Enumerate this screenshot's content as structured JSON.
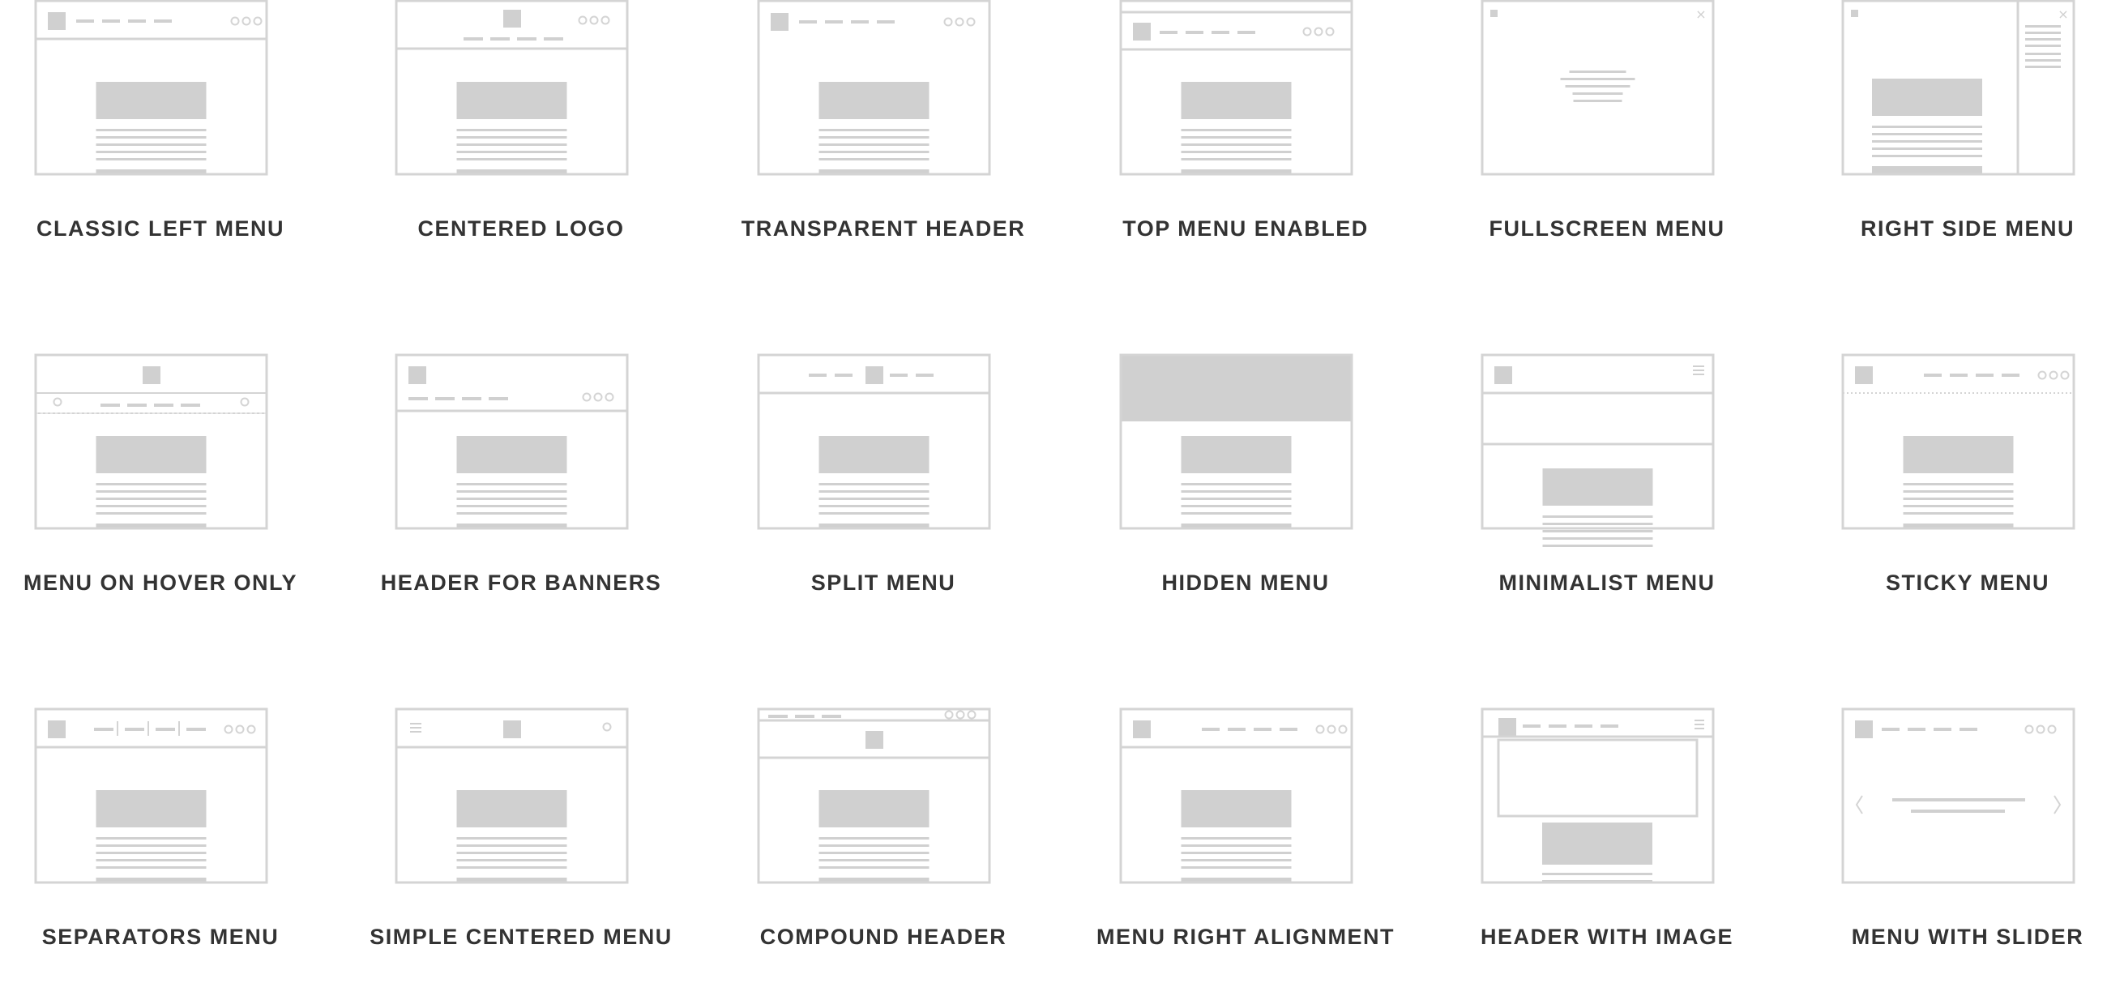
{
  "colors": {
    "stroke": "#d4d4d4",
    "fill": "#d0d0d0",
    "label": "#333333",
    "background": "#ffffff"
  },
  "options": [
    {
      "id": "classic-left-menu",
      "label": "CLASSIC LEFT MENU",
      "layout": "classic-left"
    },
    {
      "id": "centered-logo",
      "label": "CENTERED LOGO",
      "layout": "centered-logo"
    },
    {
      "id": "transparent-header",
      "label": "TRANSPARENT HEADER",
      "layout": "transparent"
    },
    {
      "id": "top-menu-enabled",
      "label": "TOP MENU ENABLED",
      "layout": "top-menu"
    },
    {
      "id": "fullscreen-menu",
      "label": "FULLSCREEN MENU",
      "layout": "fullscreen"
    },
    {
      "id": "right-side-menu",
      "label": "RIGHT SIDE MENU",
      "layout": "right-side"
    },
    {
      "id": "menu-on-hover-only",
      "label": "MENU ON HOVER ONLY",
      "layout": "hover-only"
    },
    {
      "id": "header-for-banners",
      "label": "HEADER FOR BANNERS",
      "layout": "banners"
    },
    {
      "id": "split-menu",
      "label": "SPLIT MENU",
      "layout": "split"
    },
    {
      "id": "hidden-menu",
      "label": "HIDDEN MENU",
      "layout": "hidden"
    },
    {
      "id": "minimalist-menu",
      "label": "MINIMALIST MENU",
      "layout": "minimalist"
    },
    {
      "id": "sticky-menu",
      "label": "STICKY MENU",
      "layout": "sticky"
    },
    {
      "id": "separators-menu",
      "label": "SEPARATORS MENU",
      "layout": "separators"
    },
    {
      "id": "simple-centered-menu",
      "label": "SIMPLE CENTERED MENU",
      "layout": "simple-centered"
    },
    {
      "id": "compound-header",
      "label": "COMPOUND HEADER",
      "layout": "compound"
    },
    {
      "id": "menu-right-alignment",
      "label": "MENU RIGHT ALIGNMENT",
      "layout": "right-align"
    },
    {
      "id": "header-with-image",
      "label": "HEADER WITH IMAGE",
      "layout": "with-image"
    },
    {
      "id": "menu-with-slider",
      "label": "MENU WITH SLIDER",
      "layout": "slider"
    }
  ]
}
